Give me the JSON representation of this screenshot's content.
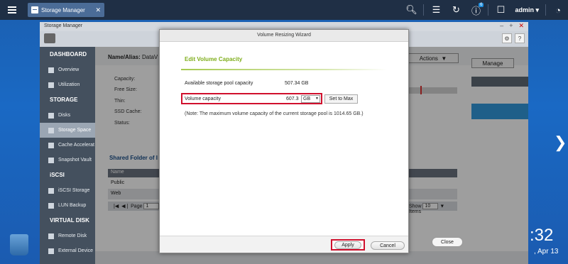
{
  "taskbar": {
    "app_tab_label": "Storage Manager",
    "notification_count": "6",
    "user": "admin ▾"
  },
  "window": {
    "title": "Storage Manager"
  },
  "sidebar": {
    "sections": [
      {
        "title": "DASHBOARD",
        "items": [
          "Overview",
          "Utilization"
        ]
      },
      {
        "title": "STORAGE",
        "items": [
          "Disks",
          "Storage Space",
          "Cache Accelerat",
          "Snapshot Vault"
        ]
      },
      {
        "title": "iSCSI",
        "items": [
          "iSCSI Storage",
          "LUN Backup"
        ]
      },
      {
        "title": "VIRTUAL DISK",
        "items": [
          "Remote Disk",
          "External Device"
        ]
      }
    ],
    "active_item": "Storage Space"
  },
  "content": {
    "name_label": "Name/Alias:",
    "name_value": "DataV",
    "actions_label": "Actions",
    "manage_label": "Manage",
    "info_labels": [
      "Capacity:",
      "Free Size:",
      "Thin:",
      "SSD Cache:",
      "Status:"
    ],
    "shared_title": "Shared Folder of I",
    "table_header": "Name",
    "table_header_hidden": "den",
    "rows": [
      "Public",
      "Web"
    ],
    "pager_page": "Page",
    "pager_page_value": "1",
    "pager_show": "Show",
    "pager_show_value": "10",
    "pager_items": "Items",
    "close_label": "Close",
    "usage_fraction": 0.33
  },
  "dialog": {
    "title": "Volume Resizing Wizard",
    "section": "Edit Volume Capacity",
    "pool_label": "Available storage pool capacity",
    "pool_value": "507.34 GB",
    "capacity_label": "Volume capacity",
    "capacity_value": "607.33",
    "unit": "GB",
    "set_max": "Set to Max",
    "note": "(Note: The maximum volume capacity of the current storage pool is 1014.65 GB.)",
    "apply": "Apply",
    "cancel": "Cancel"
  },
  "desktop": {
    "clock_time": ":32",
    "clock_date": ", Apr 13"
  },
  "colors": {
    "highlight": "#d0102d",
    "section_green": "#7fae1c",
    "selected_blue": "#3399dd"
  }
}
